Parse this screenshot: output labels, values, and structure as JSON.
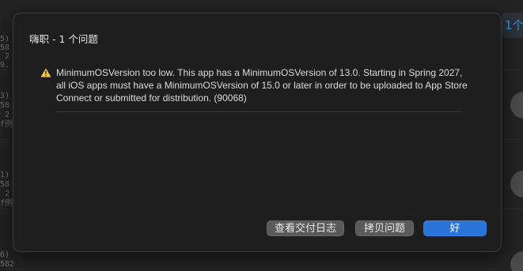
{
  "background": {
    "tab_label": "1个",
    "rows": [
      {
        "fragments": [
          "5)",
          "58",
          "2",
          "9."
        ]
      },
      {
        "fragments": [
          "3)",
          "58",
          "2",
          "f例"
        ]
      },
      {
        "fragments": [
          "1)",
          "58",
          "2",
          "f例"
        ]
      },
      {
        "fragments": [
          "6)",
          "582"
        ]
      }
    ]
  },
  "dialog": {
    "title": "嗨职 - 1 个问题",
    "issue": {
      "icon": "warning-icon",
      "text": "MinimumOSVersion too low. This app has a MinimumOSVersion of 13.0. Starting in Spring 2027, all iOS apps must have a MinimumOSVersion of 15.0 or later in order to be uploaded to App Store Connect or submitted for distribution. (90068)"
    },
    "buttons": {
      "view_log": "查看交付日志",
      "copy_issues": "拷贝问题",
      "ok": "好"
    }
  },
  "colors": {
    "primary": "#2a73d8",
    "warning": "#f2c94c",
    "sheet_bg": "#1e1e1e"
  }
}
